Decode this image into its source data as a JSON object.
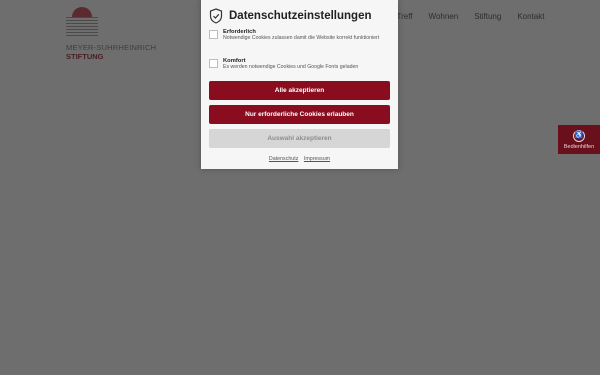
{
  "logo": {
    "name": "MEYER-SUHRHEINRICH",
    "sub": "STIFTUNG"
  },
  "nav": {
    "items": [
      "n Treff",
      "Wohnen",
      "Stiftung",
      "Kontakt"
    ]
  },
  "accessibility": {
    "label": "Bedienhilfen",
    "icon": "accessibility-icon"
  },
  "cookie_modal": {
    "title": "Datenschutzeinstellungen",
    "title_icon": "shield-check-icon",
    "options": [
      {
        "title": "Erforderlich",
        "description": "Notwendige Cookies zulassen damit die Website korrekt funktioniert",
        "checked": false
      },
      {
        "title": "Komfort",
        "description": "Es werden notwendige Cookies und Google Fonts geladen",
        "checked": false
      }
    ],
    "buttons": {
      "accept_all": "Alle akzeptieren",
      "only_required": "Nur erforderliche Cookies erlauben",
      "accept_selection": "Auswahl akzeptieren"
    },
    "links": {
      "privacy": "Datenschutz",
      "imprint": "Impressum"
    }
  },
  "colors": {
    "brand_red": "#8a0d1f",
    "overlay": "#6e6e6e",
    "disabled_button": "#d6d6d6"
  }
}
